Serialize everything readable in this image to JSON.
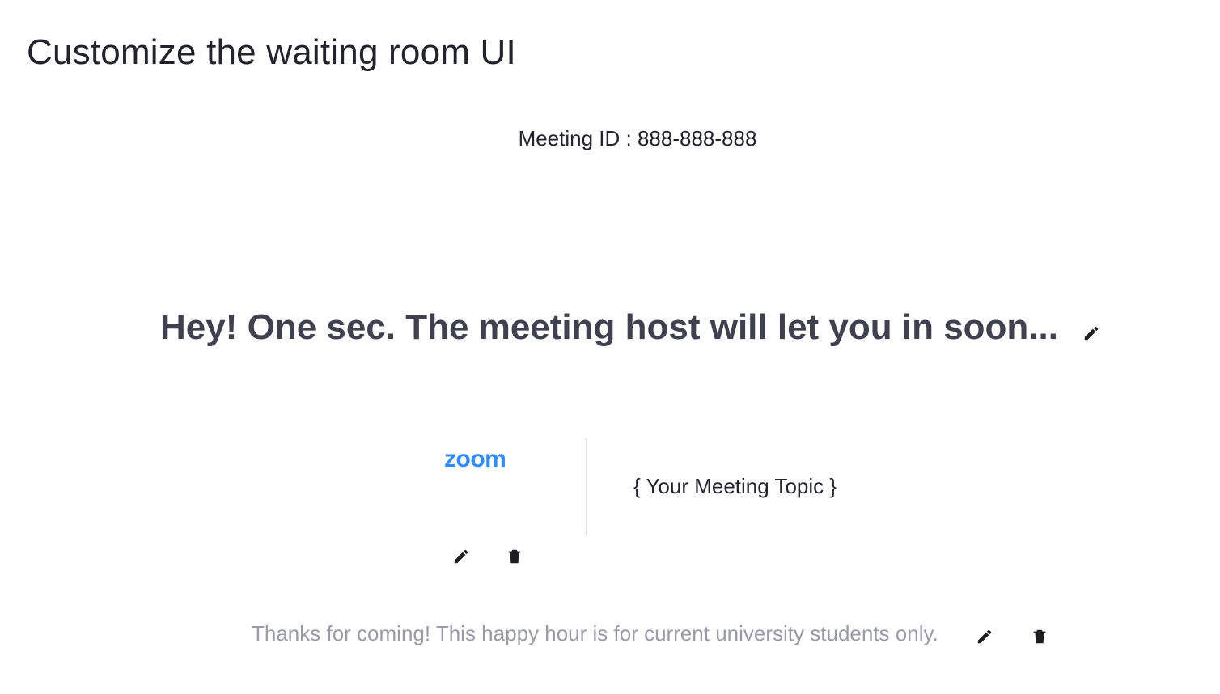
{
  "page": {
    "title": "Customize the waiting room UI"
  },
  "waiting_room": {
    "meeting_id": "Meeting ID : 888-888-888",
    "headline": "Hey! One sec. The meeting host will let you in soon...",
    "logo_text": "zoom",
    "meeting_topic": "{ Your Meeting Topic }",
    "description": "Thanks for coming! This happy hour is for current university students only."
  },
  "icons": {
    "edit": "pencil-icon",
    "delete": "trash-icon"
  },
  "colors": {
    "logo": "#2d8cff",
    "headline": "#40414f",
    "description": "#9a9aa8",
    "text": "#23232e"
  }
}
